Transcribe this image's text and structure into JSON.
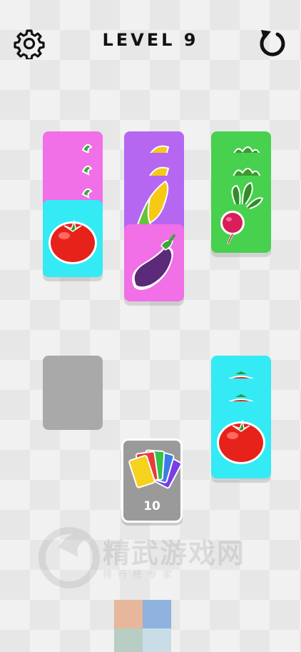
{
  "header": {
    "title": "LEVEL 9"
  },
  "deck": {
    "count": "10"
  },
  "watermark": {
    "brand": "精武游戏网",
    "tagline": "排行榜专家"
  },
  "stacks": [
    {
      "id": "stack-1",
      "color": "#f16fe7",
      "top_color": "#33eaf5",
      "top_item": "tomato",
      "hidden_items": [
        "radish-leaf",
        "radish-leaf",
        "radish-leaf"
      ]
    },
    {
      "id": "stack-2",
      "color": "#b567f2",
      "top_color": "#f16fe7",
      "top_item": "eggplant",
      "hidden_items": [
        "corn",
        "corn",
        "corn"
      ]
    },
    {
      "id": "stack-3",
      "color": "#47d14f",
      "top_color": "#47d14f",
      "top_item": "radish",
      "hidden_items": [
        "radish-leaf",
        "radish-leaf"
      ]
    },
    {
      "id": "stack-4",
      "color": "#33eaf5",
      "top_color": "#33eaf5",
      "top_item": "tomato",
      "hidden_items": [
        "tomato",
        "tomato"
      ]
    }
  ],
  "colors": {
    "pink": "#f16fe7",
    "purple": "#b567f2",
    "green": "#47d14f",
    "cyan": "#33eaf5",
    "empty_slot": "#a9a9a9",
    "deck": "#9a9a9a"
  }
}
